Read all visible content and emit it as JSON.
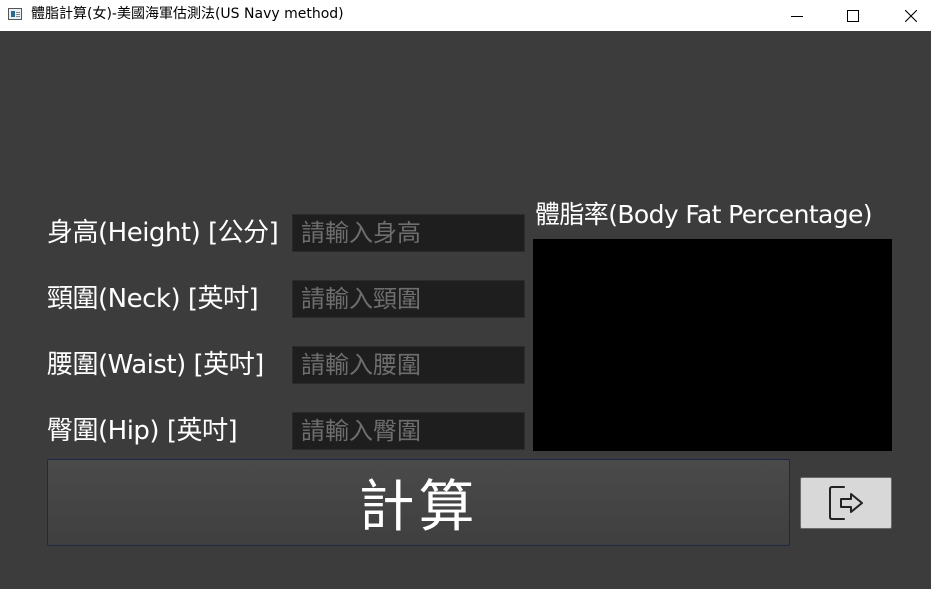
{
  "window": {
    "title": "體脂計算(女)-美國海軍估測法(US Navy method)"
  },
  "form": {
    "fields": [
      {
        "label": "身高(Height) [公分]",
        "placeholder": "請輸入身高",
        "value": ""
      },
      {
        "label": "頸圍(Neck) [英吋]",
        "placeholder": "請輸入頸圍",
        "value": ""
      },
      {
        "label": "腰圍(Waist) [英吋]",
        "placeholder": "請輸入腰圍",
        "value": ""
      },
      {
        "label": "臀圍(Hip) [英吋]",
        "placeholder": "請輸入臀圍",
        "value": ""
      }
    ]
  },
  "result": {
    "title": "體脂率(Body Fat Percentage)",
    "value": ""
  },
  "actions": {
    "calculate_label": "計算",
    "exit_icon": "exit-icon"
  },
  "colors": {
    "background": "#3c3c3c",
    "input_background": "#1e1e1e",
    "result_background": "#000000",
    "placeholder": "#6e6e6e"
  }
}
